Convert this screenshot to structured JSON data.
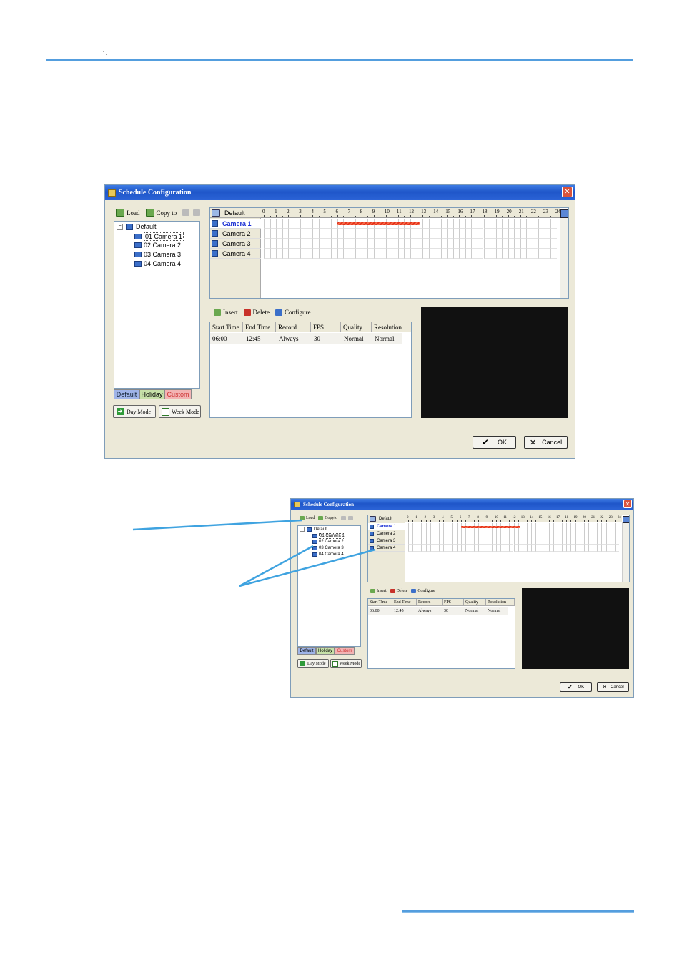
{
  "header": {
    "tiny_text": "' ."
  },
  "dialog": {
    "title": "Schedule Configuration",
    "toolbar": {
      "load": "Load",
      "copy_to": "Copy to"
    },
    "tree": {
      "root": "Default",
      "items": [
        "01 Camera 1",
        "02 Camera 2",
        "03 Camera 3",
        "04 Camera 4"
      ]
    },
    "tabs": [
      "Default",
      "Holiday",
      "Custom"
    ],
    "mode_buttons": {
      "day": "Day Mode",
      "week": "Week Mode"
    },
    "schedule": {
      "header": "Default",
      "cameras": [
        "Camera 1",
        "Camera 2",
        "Camera 3",
        "Camera 4"
      ],
      "hours": [
        "0",
        "1",
        "2",
        "3",
        "4",
        "5",
        "6",
        "7",
        "8",
        "9",
        "10",
        "11",
        "12",
        "13",
        "14",
        "15",
        "16",
        "17",
        "18",
        "19",
        "20",
        "21",
        "22",
        "23",
        "24"
      ],
      "recording_start_hour": 6.0,
      "recording_end_hour": 12.75
    },
    "actions": {
      "insert": "Insert",
      "delete": "Delete",
      "configure": "Configure"
    },
    "table": {
      "columns": [
        "Start Time",
        "End Time",
        "Record",
        "FPS",
        "Quality",
        "Resolution"
      ],
      "rows": [
        [
          "06:00",
          "12:45",
          "Always",
          "30",
          "Normal",
          "Normal"
        ]
      ]
    },
    "buttons": {
      "ok": "OK",
      "cancel": "Cancel"
    },
    "colors": {
      "title_bar": "#2b63d6",
      "selected_camera": "#1a2fd4",
      "record_bar": "#e53018",
      "tab_default": "#9fb4e8",
      "tab_holiday": "#c6e0a8",
      "tab_custom": "#f3b4b4"
    }
  },
  "dialog_small": {
    "toolbar": {
      "copy_to": "Copyto"
    }
  }
}
